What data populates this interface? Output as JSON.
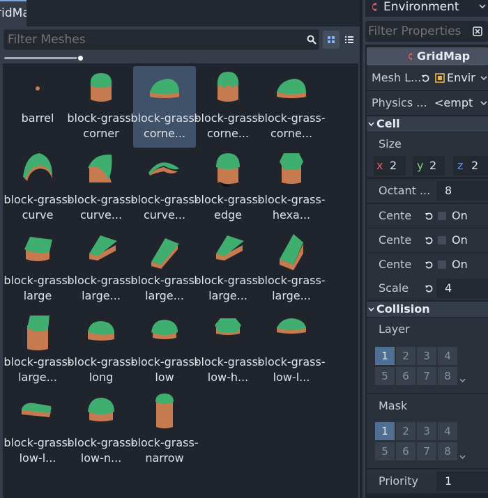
{
  "left_panel": {
    "tab_label": "GridMap",
    "filter_placeholder": "Filter Meshes",
    "meshes": [
      {
        "label": "barrel",
        "shape": "barrel"
      },
      {
        "label": "block-grass-corner",
        "shape": "cube"
      },
      {
        "label": "block-grass-corne...",
        "shape": "wedge",
        "selected": true
      },
      {
        "label": "block-grass-corne...",
        "shape": "cube-drip"
      },
      {
        "label": "block-grass-corne...",
        "shape": "wedge"
      },
      {
        "label": "block-grass-curve",
        "shape": "arch"
      },
      {
        "label": "block-grass-curve...",
        "shape": "ramp"
      },
      {
        "label": "block-grass-curve...",
        "shape": "arch-thin"
      },
      {
        "label": "block-grass-edge",
        "shape": "edge"
      },
      {
        "label": "block-grass-hexa...",
        "shape": "hex"
      },
      {
        "label": "block-grass-large",
        "shape": "slab"
      },
      {
        "label": "block-grass-large...",
        "shape": "slab-tilt"
      },
      {
        "label": "block-grass-large...",
        "shape": "slope"
      },
      {
        "label": "block-grass-large...",
        "shape": "slab-tilt"
      },
      {
        "label": "block-grass-large...",
        "shape": "slope-tall"
      },
      {
        "label": "block-grass-large...",
        "shape": "tall"
      },
      {
        "label": "block-grass-long",
        "shape": "long"
      },
      {
        "label": "block-grass-low",
        "shape": "low"
      },
      {
        "label": "block-grass-low-h...",
        "shape": "low-hex"
      },
      {
        "label": "block-grass-low-l...",
        "shape": "low-flat"
      },
      {
        "label": "block-grass-low-l...",
        "shape": "low-long"
      },
      {
        "label": "block-grass-low-n...",
        "shape": "low-round"
      },
      {
        "label": "block-grass-narrow",
        "shape": "narrow"
      }
    ]
  },
  "inspector": {
    "env_title": "Environment",
    "filter_placeholder": "Filter Properties",
    "node_name": "GridMap",
    "mesh_library_label": "Mesh L...",
    "mesh_library_value": "Envir",
    "physics_label": "Physics ...",
    "physics_value": "<empt",
    "cell_section": "Cell",
    "size_label": "Size",
    "size_x_axis": "x",
    "size_x": "2",
    "size_y_axis": "y",
    "size_y": "2",
    "size_z_axis": "z",
    "size_z": "2",
    "octant_label": "Octant ...",
    "octant_value": "8",
    "center_x_label": "Cente",
    "center_x_value": "On",
    "center_y_label": "Cente",
    "center_y_value": "On",
    "center_z_label": "Cente",
    "center_z_value": "On",
    "scale_label": "Scale",
    "scale_value": "4",
    "collision_section": "Collision",
    "layer_label": "Layer",
    "layer_cells": [
      "1",
      "2",
      "3",
      "4",
      "5",
      "6",
      "7",
      "8"
    ],
    "layer_active": [
      1
    ],
    "mask_label": "Mask",
    "mask_cells": [
      "1",
      "2",
      "3",
      "4",
      "5",
      "6",
      "7",
      "8"
    ],
    "mask_active": [
      1
    ],
    "priority_label": "Priority",
    "priority_value": "1"
  },
  "colors": {
    "accent": "#7aa6e6",
    "grass": "#3fae6e",
    "dirt": "#c77a4f",
    "godot_red": "#e0606a"
  }
}
